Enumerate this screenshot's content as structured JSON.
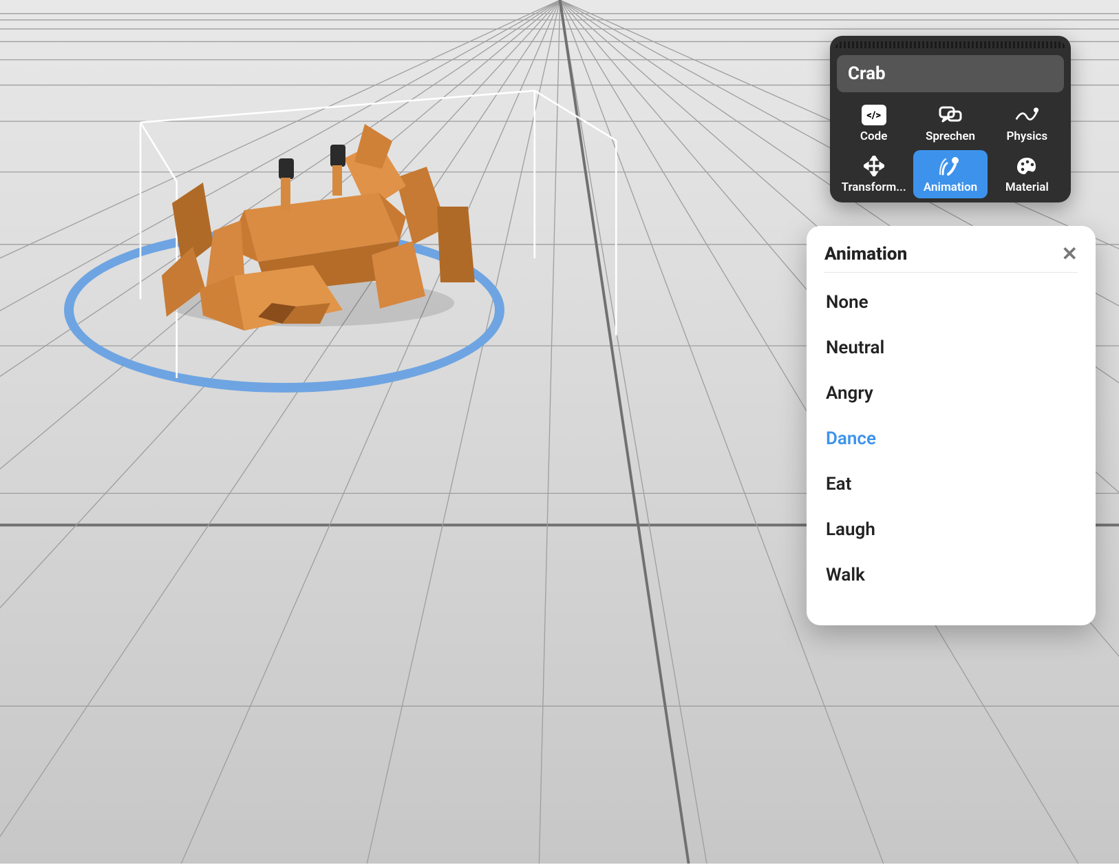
{
  "object_name": "Crab",
  "tabs": {
    "code": {
      "label": "Code"
    },
    "speak": {
      "label": "Sprechen"
    },
    "physics": {
      "label": "Physics"
    },
    "transform": {
      "label": "Transform..."
    },
    "animation": {
      "label": "Animation"
    },
    "material": {
      "label": "Material"
    }
  },
  "active_tab": "animation",
  "popover": {
    "title": "Animation",
    "options": [
      {
        "label": "None"
      },
      {
        "label": "Neutral"
      },
      {
        "label": "Angry"
      },
      {
        "label": "Dance",
        "selected": true
      },
      {
        "label": "Eat"
      },
      {
        "label": "Laugh"
      },
      {
        "label": "Walk"
      }
    ]
  },
  "colors": {
    "accent": "#3d93ec",
    "ring": "#6ea4e2",
    "crab": "#d98a3f"
  }
}
